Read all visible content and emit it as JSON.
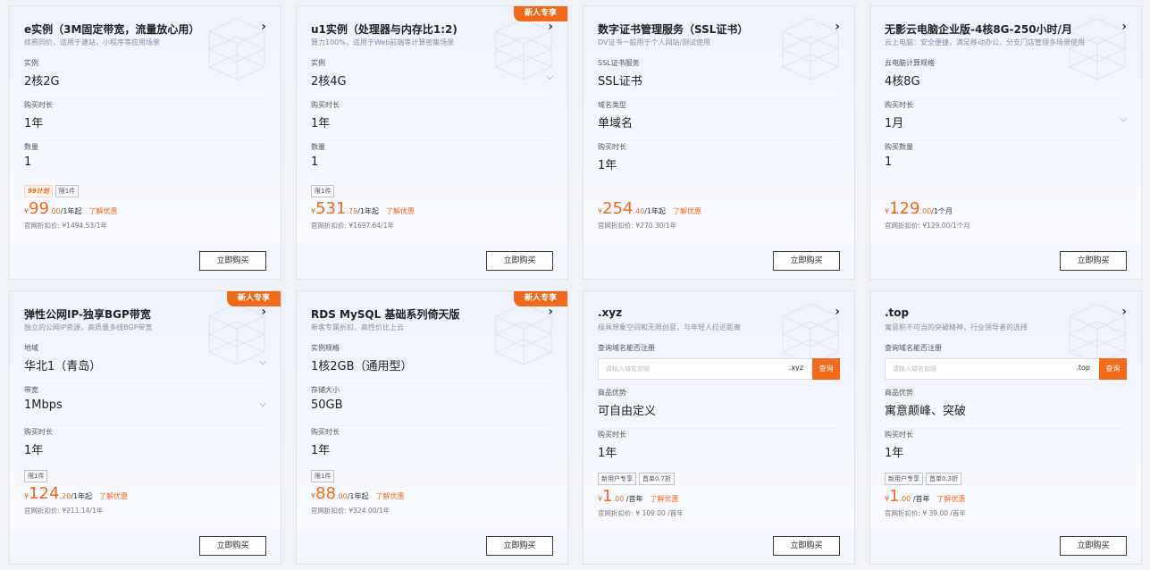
{
  "cards": [
    {
      "title": "e实例（3M固定带宽，流量放心用）",
      "desc": "续费同价，适用于建站，小程序等应用场景",
      "ribbon": "",
      "fields": [
        {
          "label": "实例",
          "value": "2核2G",
          "chev": ""
        },
        {
          "label": "购买时长",
          "value": "1年",
          "chev": ""
        },
        {
          "label": "数量",
          "value": "1",
          "chev": ""
        }
      ],
      "tags": [
        {
          "text": "99计划",
          "hot": true
        },
        {
          "text": "限1件",
          "hot": false
        }
      ],
      "price": {
        "cur": "¥",
        "big": "99",
        "dec": ".00",
        "unit": "/1年起",
        "promo": "了解优惠"
      },
      "orig": "官网折扣价: ¥1494.53/1年",
      "buy": "立即购买"
    },
    {
      "title": "u1实例（处理器与内存比1:2)",
      "desc": "算力100%，适用于Web前端等计算密集场景",
      "ribbon": "新人专享",
      "fields": [
        {
          "label": "实例",
          "value": "2核4G",
          "chev": "⌵"
        },
        {
          "label": "购买时长",
          "value": "1年",
          "chev": ""
        },
        {
          "label": "数量",
          "value": "1",
          "chev": ""
        }
      ],
      "tags": [
        {
          "text": "限1件",
          "hot": false
        }
      ],
      "price": {
        "cur": "¥",
        "big": "531",
        "dec": ".79",
        "unit": "/1年起",
        "promo": "了解优惠"
      },
      "orig": "官网折扣价: ¥1697.64/1年",
      "buy": "立即购买"
    },
    {
      "title": "数字证书管理服务（SSL证书）",
      "desc": "DV证书一般用于个人网站/测试使用",
      "ribbon": "",
      "fields": [
        {
          "label": "SSL证书服务",
          "value": "SSL证书",
          "chev": ""
        },
        {
          "label": "域名类型",
          "value": "单域名",
          "chev": ""
        },
        {
          "label": "购买时长",
          "value": "1年",
          "chev": ""
        }
      ],
      "tags": [],
      "price": {
        "cur": "¥",
        "big": "254",
        "dec": ".40",
        "unit": "/1年起",
        "promo": "了解优惠"
      },
      "orig": "官网折扣价: ¥270.30/1年",
      "buy": "立即购买"
    },
    {
      "title": "无影云电脑企业版-4核8G-250小时/月",
      "desc": "云上电脑：安全便捷，满足移动办公、分支门店管理多场景使用",
      "ribbon": "",
      "fields": [
        {
          "label": "云电脑计算规格",
          "value": "4核8G",
          "chev": ""
        },
        {
          "label": "购买时长",
          "value": "1月",
          "chev": "⌵"
        },
        {
          "label": "购买数量",
          "value": "1",
          "chev": ""
        }
      ],
      "tags": [],
      "price": {
        "cur": "¥",
        "big": "129",
        "dec": ".00",
        "unit": "/1个月",
        "promo": ""
      },
      "orig": "官网折扣价: ¥129.00/1个月",
      "buy": "立即购买"
    },
    {
      "title": "弹性公网IP-独享BGP带宽",
      "desc": "独立的公网IP资源，高质量多线BGP带宽",
      "ribbon": "新人专享",
      "fields": [
        {
          "label": "地域",
          "value": "华北1（青岛）",
          "chev": "⌵"
        },
        {
          "label": "带宽",
          "value": "1Mbps",
          "chev": "⌵"
        },
        {
          "label": "购买时长",
          "value": "1年",
          "chev": ""
        }
      ],
      "tags": [
        {
          "text": "限1件",
          "hot": false
        }
      ],
      "price": {
        "cur": "¥",
        "big": "124",
        "dec": ".20",
        "unit": "/1年起",
        "promo": "了解优惠"
      },
      "orig": "官网折扣价: ¥211.14/1年",
      "buy": "立即购买"
    },
    {
      "title": "RDS MySQL 基础系列倚天版",
      "desc": "新客专属折扣，高性价比上云",
      "ribbon": "新人专享",
      "fields": [
        {
          "label": "实例规格",
          "value": "1核2GB（通用型）",
          "chev": ""
        },
        {
          "label": "存储大小",
          "value": "50GB",
          "chev": ""
        },
        {
          "label": "购买时长",
          "value": "1年",
          "chev": ""
        }
      ],
      "tags": [
        {
          "text": "限1件",
          "hot": false
        }
      ],
      "price": {
        "cur": "¥",
        "big": "88",
        "dec": ".00",
        "unit": "/1年起",
        "promo": "了解优惠"
      },
      "orig": "官网折扣价: ¥324.00/1年",
      "buy": "立即购买"
    },
    {
      "title": ".xyz",
      "desc": "极具想象空间和无限创意，与年轻人拉近距离",
      "ribbon": "",
      "domain": {
        "label": "查询域名能否注册",
        "placeholder": "请输入域名前缀",
        "suffix": ".xyz",
        "button": "查询"
      },
      "fields": [
        {
          "label": "商品优势",
          "value": "可自由定义",
          "chev": ""
        },
        {
          "label": "购买时长",
          "value": "1年",
          "chev": ""
        }
      ],
      "tags": [
        {
          "text": "新用户专享",
          "hot": false
        },
        {
          "text": "首单0.7折",
          "hot": false
        }
      ],
      "price": {
        "cur": "¥",
        "big": "1",
        "dec": ".00",
        "unit": " /首年",
        "promo": "了解优惠"
      },
      "orig": "官网折扣价: ¥ 109.00 /首年",
      "buy": "立即购买"
    },
    {
      "title": ".top",
      "desc": "寓意积不可当的突破精神，行业领导者的选择",
      "ribbon": "",
      "domain": {
        "label": "查询域名能否注册",
        "placeholder": "请输入域名前缀",
        "suffix": ".top",
        "button": "查询"
      },
      "fields": [
        {
          "label": "商品优势",
          "value": "寓意颠峰、突破",
          "chev": ""
        },
        {
          "label": "购买时长",
          "value": "1年",
          "chev": ""
        }
      ],
      "tags": [
        {
          "text": "新用户专享",
          "hot": false
        },
        {
          "text": "首单0.3折",
          "hot": false
        }
      ],
      "price": {
        "cur": "¥",
        "big": "1",
        "dec": ".00",
        "unit": " /首年",
        "promo": "了解优惠"
      },
      "orig": "官网折扣价: ¥ 39.00 /首年",
      "buy": "立即购买"
    }
  ]
}
